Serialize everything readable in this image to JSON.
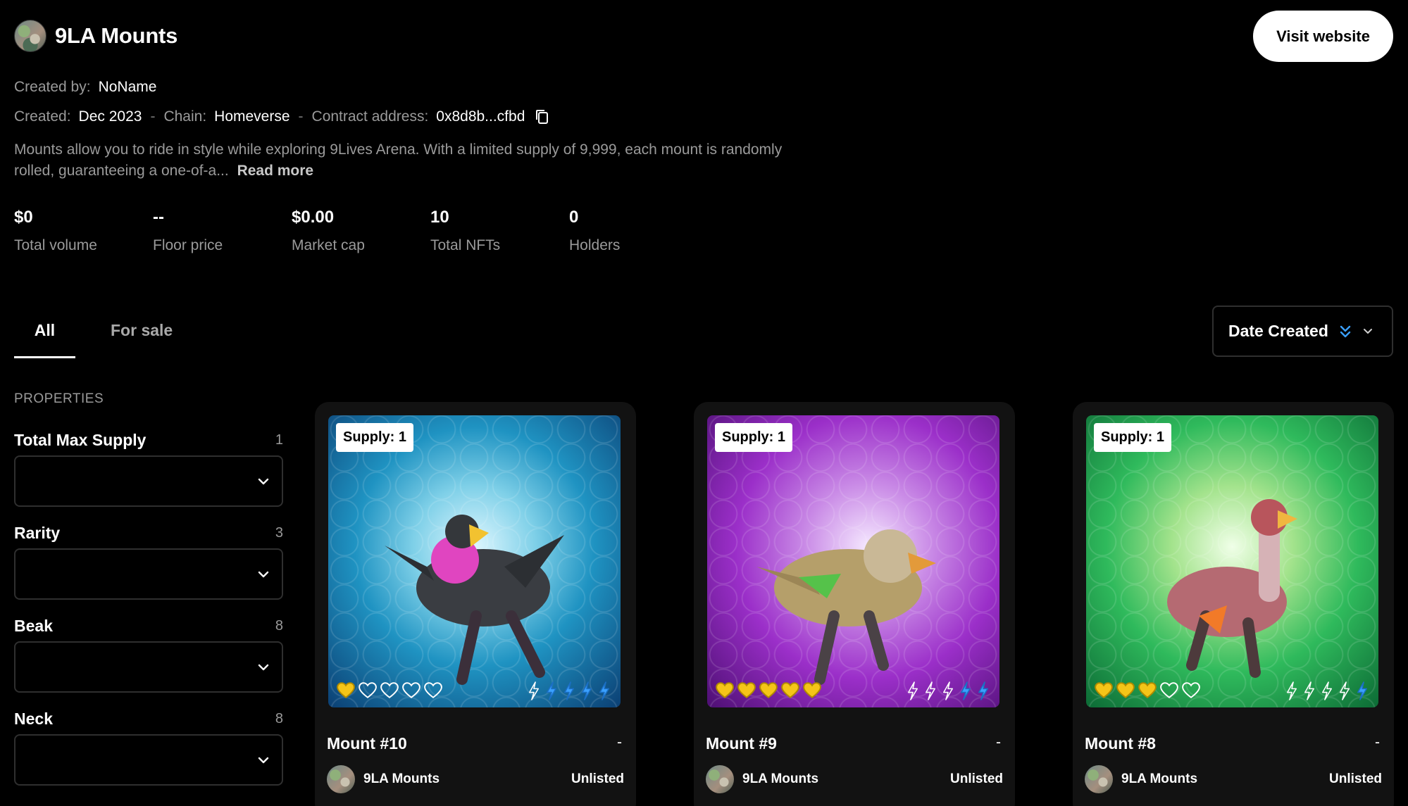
{
  "header": {
    "collection_name": "9LA Mounts",
    "visit_button": "Visit website"
  },
  "meta": {
    "created_by_label": "Created by:",
    "created_by_value": "NoName",
    "created_label": "Created:",
    "created_value": "Dec 2023",
    "separator": "-",
    "chain_label": "Chain:",
    "chain_value": "Homeverse",
    "contract_label": "Contract address:",
    "contract_value": "0x8d8b...cfbd",
    "copy_icon": "copy-icon"
  },
  "description": {
    "text": "Mounts allow you to ride in style while exploring 9Lives Arena. With a limited supply of 9,999, each mount is randomly rolled, guaranteeing a one-of-a...",
    "read_more": "Read more"
  },
  "stats": [
    {
      "value": "$0",
      "label": "Total volume"
    },
    {
      "value": "--",
      "label": "Floor price"
    },
    {
      "value": "$0.00",
      "label": "Market cap"
    },
    {
      "value": "10",
      "label": "Total NFTs"
    },
    {
      "value": "0",
      "label": "Holders"
    }
  ],
  "tabs": [
    {
      "label": "All",
      "active": true
    },
    {
      "label": "For sale",
      "active": false
    }
  ],
  "sort": {
    "label": "Date Created",
    "direction_icon": "sort-descending-icon",
    "dropdown_icon": "chevron-down-icon"
  },
  "properties": {
    "heading": "PROPERTIES",
    "items": [
      {
        "name": "Total Max Supply",
        "count": "1"
      },
      {
        "name": "Rarity",
        "count": "3"
      },
      {
        "name": "Beak",
        "count": "8"
      },
      {
        "name": "Neck",
        "count": "8"
      }
    ]
  },
  "cards": [
    {
      "name": "Mount #10",
      "price": "-",
      "supply": "Supply: 1",
      "collection": "9LA Mounts",
      "status": "Unlisted",
      "hearts_filled": 1,
      "hearts_total": 5,
      "bolts_filled": 4,
      "bolts_total": 5,
      "theme": "blue"
    },
    {
      "name": "Mount #9",
      "price": "-",
      "supply": "Supply: 1",
      "collection": "9LA Mounts",
      "status": "Unlisted",
      "hearts_filled": 5,
      "hearts_total": 5,
      "bolts_filled": 2,
      "bolts_total": 5,
      "theme": "purple"
    },
    {
      "name": "Mount #8",
      "price": "-",
      "supply": "Supply: 1",
      "collection": "9LA Mounts",
      "status": "Unlisted",
      "hearts_filled": 3,
      "hearts_total": 5,
      "bolts_filled": 1,
      "bolts_total": 5,
      "theme": "green"
    }
  ],
  "colors": {
    "background": "#000000",
    "muted_text": "#9a9a9a",
    "heart": "#f5c518",
    "bolt": "#3aa0ff",
    "sort_icon": "#3aa0ff"
  }
}
